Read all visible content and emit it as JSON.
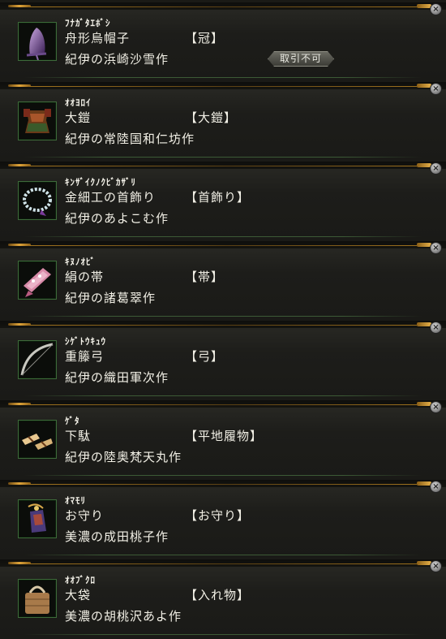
{
  "items": [
    {
      "kana": "ﾌﾅｶﾞﾀｴﾎﾞｼ",
      "name": "舟形烏帽子",
      "slot": "【冠】",
      "maker": "紀伊の浜崎沙雪作",
      "badge": "取引不可",
      "icon": "eboshi-hat-icon"
    },
    {
      "kana": "ｵｵﾖﾛｲ",
      "name": "大鎧",
      "slot": "【大鎧】",
      "maker": "紀伊の常陸国和仁坊作",
      "icon": "armor-icon"
    },
    {
      "kana": "ｷﾝｻﾞｲｸﾉｸﾋﾞｶｻﾞﾘ",
      "name": "金細工の首飾り",
      "slot": "【首飾り】",
      "maker": "紀伊のあよこむ作",
      "icon": "necklace-icon"
    },
    {
      "kana": "ｷﾇﾉｵﾋﾞ",
      "name": "絹の帯",
      "slot": "【帯】",
      "maker": "紀伊の諸葛翠作",
      "icon": "obi-sash-icon"
    },
    {
      "kana": "ｼｹﾞﾄｳｷｭｳ",
      "name": "重籐弓",
      "slot": "【弓】",
      "maker": "紀伊の織田軍次作",
      "icon": "bow-icon"
    },
    {
      "kana": "ｹﾞﾀ",
      "name": "下駄",
      "slot": "【平地履物】",
      "maker": "紀伊の陸奥梵天丸作",
      "icon": "geta-sandals-icon"
    },
    {
      "kana": "ｵﾏﾓﾘ",
      "name": "お守り",
      "slot": "【お守り】",
      "maker": "美濃の成田桃子作",
      "icon": "omamori-charm-icon"
    },
    {
      "kana": "ｵｵﾌﾞｸﾛ",
      "name": "大袋",
      "slot": "【入れ物】",
      "maker": "美濃の胡桃沢あよ作",
      "icon": "bag-icon"
    }
  ],
  "close_symbol": "×"
}
